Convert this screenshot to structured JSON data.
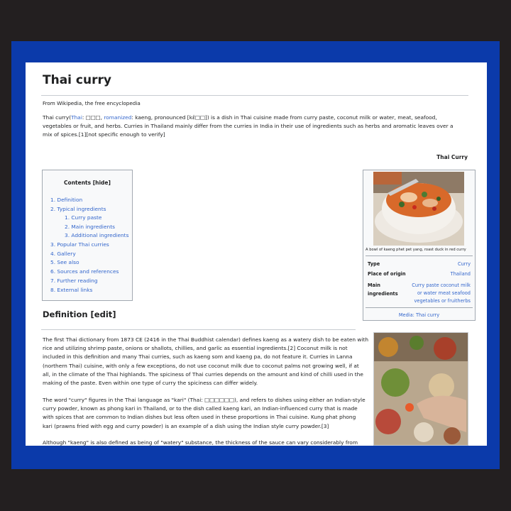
{
  "article": {
    "title": "Thai curry",
    "from": "From Wikipedia, the free encyclopedia",
    "intro_lines": [
      [
        "Thai curry(",
        "Thai",
        ": □□□, ",
        "romanized",
        ": kaeng, pronounced [kɛ̄□□]) is a dish in Thai cuisine made from curry paste, coconut milk or water, meat, seafood,"
      ],
      "vegetables or fruit, and herbs. Curries in Thailand mainly differ from the curries in India in their use of ingredients such as herbs and aromatic leaves over a",
      "mix of spices.[1][not specific enough to verify]"
    ]
  },
  "infobox": {
    "caption": "Thai Curry",
    "image_caption": "A bowl of kaeng phet pet yang, roast duck in red curry",
    "rows": [
      {
        "label": "Type",
        "value": [
          "Curry"
        ]
      },
      {
        "label": "Place of origin",
        "value": [
          "Thailand"
        ]
      },
      {
        "label": [
          "Main",
          "ingredients"
        ],
        "value": [
          "Curry paste coconut milk",
          "or water meat seafood",
          "vegetables or fruitherbs"
        ]
      }
    ],
    "media": "Media: Thai curry"
  },
  "toc": {
    "title": "Contents [hide]",
    "items": [
      "1. Definition",
      "2. Typical ingredients",
      "1. Curry paste",
      "2. Main ingredients",
      "3. Additional ingredients",
      "3. Popular Thai curries",
      "4. Gallery",
      "5. See also",
      "6. Sources and references",
      "7. Further reading",
      "8. External links"
    ]
  },
  "definition": {
    "heading": "Definition [edit]",
    "para1": [
      "The first Thai dictionary from 1873 CE (2416 in the Thai Buddhist calendar) defines kaeng as a watery dish to be eaten with",
      "rice and utilizing shrimp paste, onions or shallots, chillies, and garlic as essential ingredients.[2] Coconut milk is not",
      "included in this definition and many Thai curries, such as kaeng som and kaeng pa, do not feature it. Curries in Lanna",
      "(northern Thai) cuisine, with only a few exceptions, do not use coconut milk due to coconut palms not growing well, if at",
      "all, in the climate of the Thai highlands. The spiciness of Thai curries depends on the amount and kind of chilli used in the",
      "making of the paste. Even within one type of curry the spiciness can differ widely."
    ],
    "para2": [
      "The word \"curry\" figures in the Thai language as \"kari\" (Thai: □□□□□□), and refers to dishes using either an Indian-style",
      "curry powder, known as phong kari in Thailand, or to the dish called kaeng kari, an Indian-influenced curry that is made",
      "with spices that are common to Indian dishes but less often used in these proportions in Thai cuisine. Kung phat phong",
      "kari (prawns fried with egg and curry powder) is an example of a dish using the Indian style curry powder.[3]"
    ],
    "para3": [
      "Although \"kaeng\" is also defined as being of \"watery\" substance, the thickness of the sauce can vary considerably from"
    ]
  },
  "colors": {
    "frame_blue": "#0b3aaa",
    "link": "#3366cc",
    "background": "#231f20"
  }
}
